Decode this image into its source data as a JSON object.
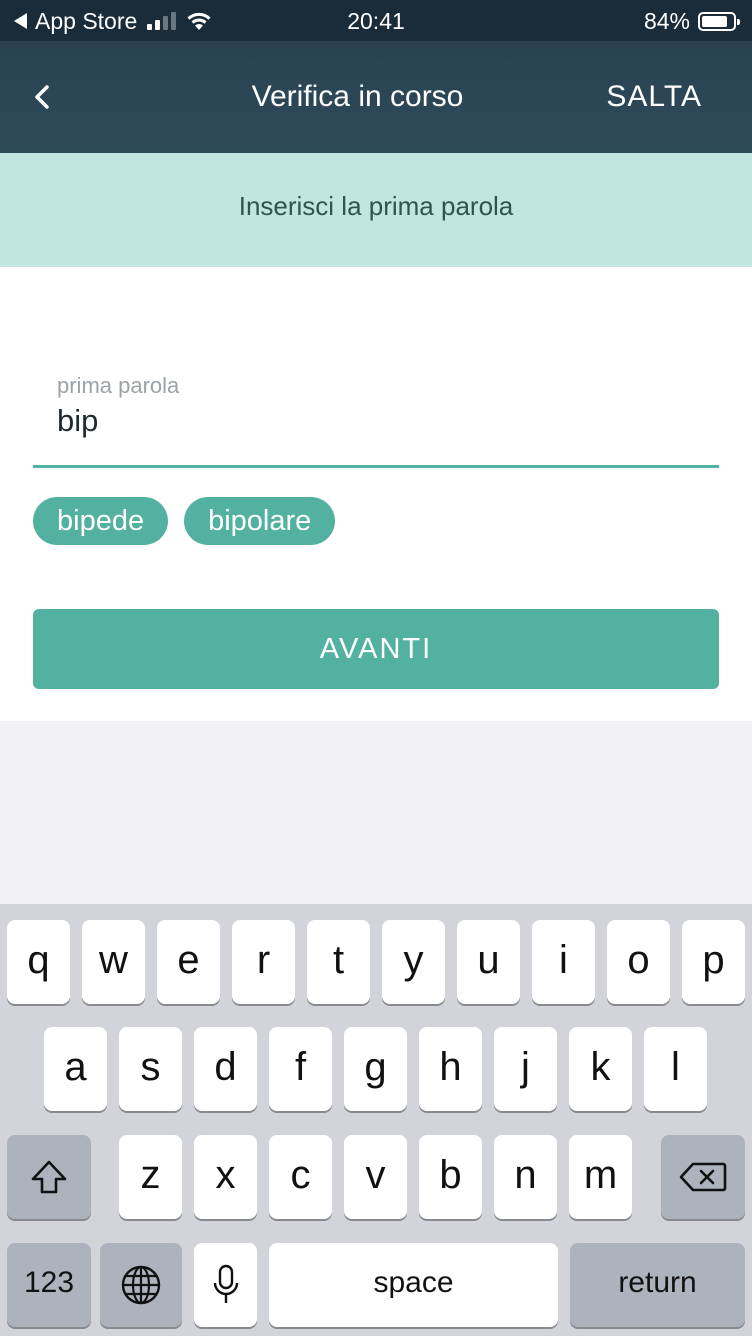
{
  "status_bar": {
    "back_app": "App Store",
    "time": "20:41",
    "battery": "84%",
    "battery_level": 0.84
  },
  "nav": {
    "back_icon": "chevron-left-icon",
    "title": "Verifica in corso",
    "skip_label": "SALTA"
  },
  "banner": {
    "text": "Inserisci la prima parola"
  },
  "form": {
    "field_label": "prima parola",
    "field_value": "bip",
    "suggestions": [
      "bipede",
      "bipolare"
    ],
    "next_label": "AVANTI"
  },
  "keyboard": {
    "row1": [
      "q",
      "w",
      "e",
      "r",
      "t",
      "y",
      "u",
      "i",
      "o",
      "p"
    ],
    "row2": [
      "a",
      "s",
      "d",
      "f",
      "g",
      "h",
      "j",
      "k",
      "l"
    ],
    "row3": [
      "z",
      "x",
      "c",
      "v",
      "b",
      "n",
      "m"
    ],
    "numbers_label": "123",
    "space_label": "space",
    "return_label": "return",
    "shift_icon": "shift-icon",
    "backspace_icon": "backspace-icon",
    "globe_icon": "globe-icon",
    "mic_icon": "microphone-icon"
  },
  "colors": {
    "accent": "#53b1a1",
    "nav_background": "#2d4a58",
    "banner_background": "#c1e5e0"
  }
}
